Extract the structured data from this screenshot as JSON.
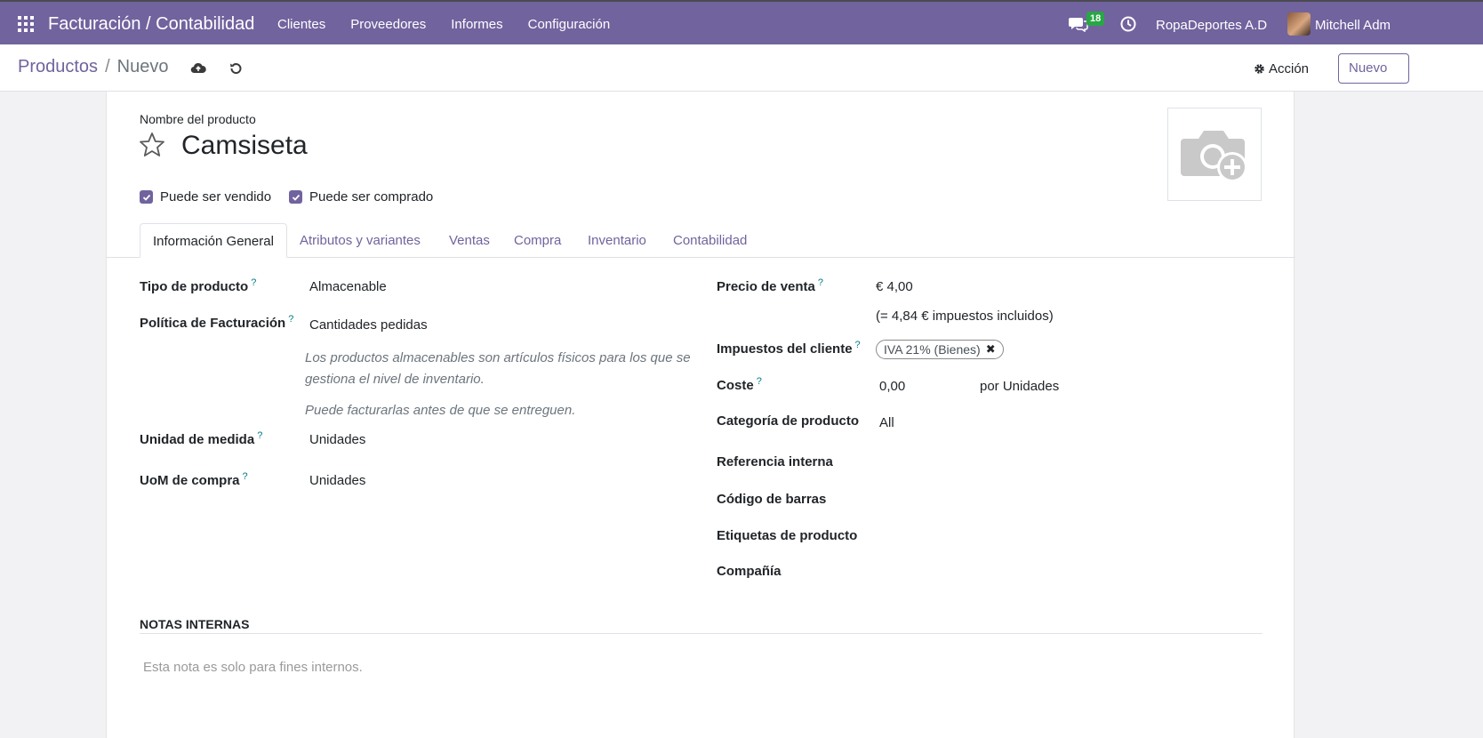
{
  "navbar": {
    "app_title": "Facturación / Contabilidad",
    "menu": [
      "Clientes",
      "Proveedores",
      "Informes",
      "Configuración"
    ],
    "chat_badge": "18",
    "company": "RopaDeportes A.D",
    "user": "Mitchell Adm",
    "color": "#71639e"
  },
  "control": {
    "breadcrumb_parent": "Productos",
    "breadcrumb_sep": "/",
    "breadcrumb_current": "Nuevo",
    "action_label": "Acción",
    "new_label": "Nuevo"
  },
  "form": {
    "name_label": "Nombre del producto",
    "product_name": "Camsiseta",
    "can_be_sold": "Puede ser vendido",
    "can_be_purchased": "Puede ser comprado",
    "tabs": [
      "Información General",
      "Atributos y variantes",
      "Ventas",
      "Compra",
      "Inventario",
      "Contabilidad"
    ],
    "left": {
      "product_type_label": "Tipo de producto",
      "product_type": "Almacenable",
      "invoice_policy_label": "Política de Facturación",
      "invoice_policy": "Cantidades pedidas",
      "help1": "Los productos almacenables son artículos físicos para los que se gestiona el nivel de inventario.",
      "help2": "Puede facturarlas antes de que se entreguen.",
      "uom_label": "Unidad de medida",
      "uom": "Unidades",
      "uom_po_label": "UoM de compra",
      "uom_po": "Unidades"
    },
    "right": {
      "sale_price_label": "Precio de venta",
      "sale_price": "€ 4,00",
      "tax_included": "(= 4,84 € impuestos incluidos)",
      "customer_taxes_label": "Impuestos del cliente",
      "customer_tax_tag": "IVA 21% (Bienes)",
      "cost_label": "Coste",
      "cost": "0,00",
      "cost_unit": "por Unidades",
      "category_label": "Categoría de producto",
      "category": "All",
      "internal_ref_label": "Referencia interna",
      "barcode_label": "Código de barras",
      "tags_label": "Etiquetas de producto",
      "company_label": "Compañía"
    },
    "notes_title": "NOTAS INTERNAS",
    "notes_placeholder": "Esta nota es solo para fines internos.",
    "help_mark": "?"
  }
}
